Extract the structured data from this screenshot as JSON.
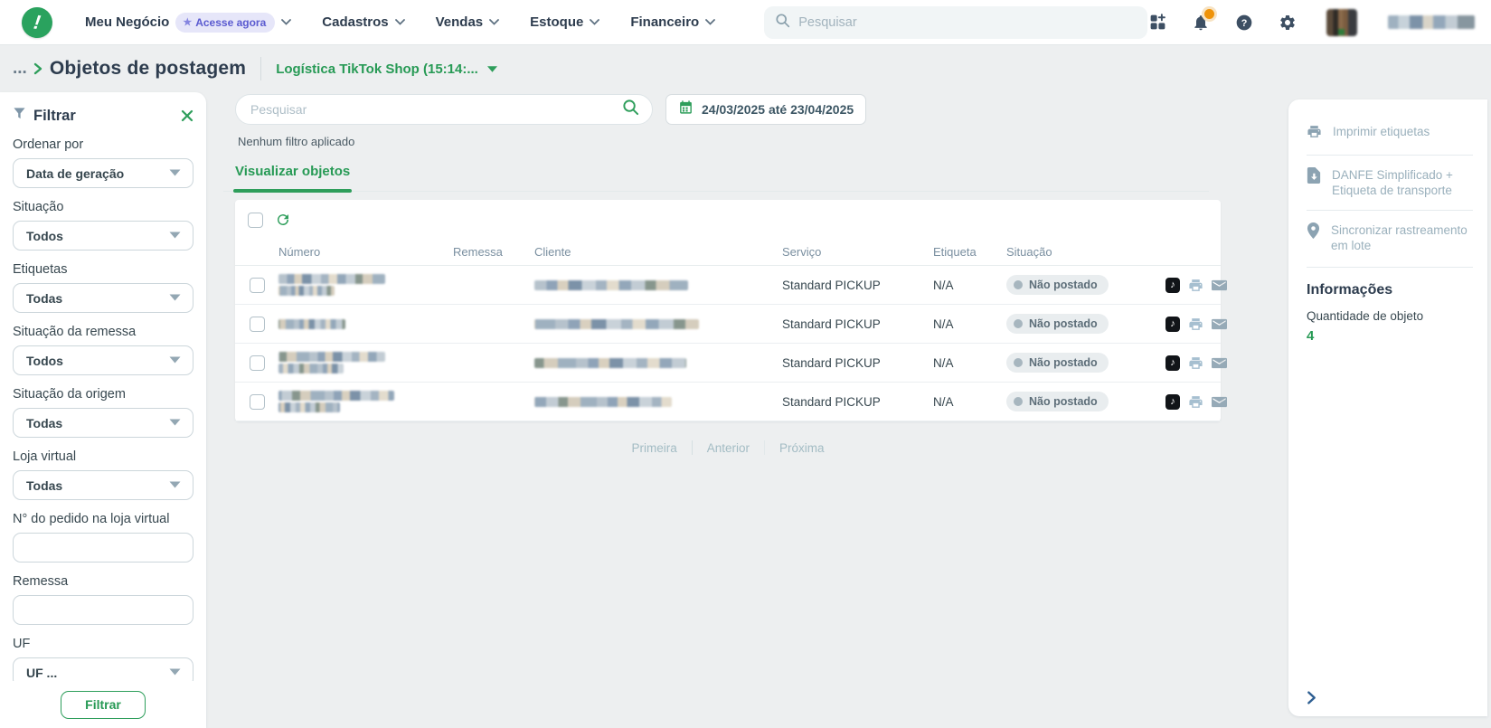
{
  "topbar": {
    "logo_glyph": "!",
    "menu": [
      {
        "label": "Meu Negócio",
        "badge": "Acesse agora"
      },
      {
        "label": "Cadastros"
      },
      {
        "label": "Vendas"
      },
      {
        "label": "Estoque"
      },
      {
        "label": "Financeiro"
      }
    ],
    "search_placeholder": "Pesquisar",
    "icons": [
      "apps-grid-plus-icon",
      "notifications-bell-icon",
      "help-icon",
      "settings-gear-icon"
    ]
  },
  "breadcrumb": {
    "ellipsis": "...",
    "title": "Objetos de postagem",
    "context_selector": "Logística TikTok Shop (15:14:..."
  },
  "filter_panel": {
    "title": "Filtrar",
    "fields": [
      {
        "label": "Ordenar por",
        "type": "select",
        "value": "Data de geração"
      },
      {
        "label": "Situação",
        "type": "select",
        "value": "Todos"
      },
      {
        "label": "Etiquetas",
        "type": "select",
        "value": "Todas"
      },
      {
        "label": "Situação da remessa",
        "type": "select",
        "value": "Todos"
      },
      {
        "label": "Situação da origem",
        "type": "select",
        "value": "Todas"
      },
      {
        "label": "Loja virtual",
        "type": "select",
        "value": "Todas"
      },
      {
        "label": "N° do pedido na loja virtual",
        "type": "input",
        "value": ""
      },
      {
        "label": "Remessa",
        "type": "input",
        "value": ""
      },
      {
        "label": "UF",
        "type": "select",
        "value": "UF ..."
      }
    ],
    "submit_label": "Filtrar"
  },
  "toolbar": {
    "search_placeholder": "Pesquisar",
    "date_range": "24/03/2025 até 23/04/2025",
    "filter_status": "Nenhum filtro aplicado"
  },
  "tabs": [
    {
      "label": "Visualizar objetos",
      "active": true
    }
  ],
  "table": {
    "columns": [
      "Número",
      "Remessa",
      "Cliente",
      "Serviço",
      "Etiqueta",
      "Situação"
    ],
    "rows": [
      {
        "numero_redacted_lines": 2,
        "remessa": "",
        "cliente_redacted": true,
        "servico": "Standard PICKUP",
        "etiqueta": "N/A",
        "situacao": "Não postado"
      },
      {
        "numero_redacted_lines": 1,
        "remessa": "",
        "cliente_redacted": true,
        "servico": "Standard PICKUP",
        "etiqueta": "N/A",
        "situacao": "Não postado"
      },
      {
        "numero_redacted_lines": 2,
        "remessa": "",
        "cliente_redacted": true,
        "servico": "Standard PICKUP",
        "etiqueta": "N/A",
        "situacao": "Não postado"
      },
      {
        "numero_redacted_lines": 2,
        "remessa": "",
        "cliente_redacted": true,
        "servico": "Standard PICKUP",
        "etiqueta": "N/A",
        "situacao": "Não postado"
      }
    ],
    "row_action_icons": [
      "tiktok-shop-icon",
      "print-icon",
      "email-icon"
    ]
  },
  "pagination": {
    "links": [
      "Primeira",
      "Anterior",
      "Próxima"
    ]
  },
  "side_panel": {
    "actions": [
      {
        "label": "Imprimir etiquetas",
        "icon": "print-icon"
      },
      {
        "label": "DANFE Simplificado + Etiqueta de transporte",
        "icon": "file-download-icon"
      },
      {
        "label": "Sincronizar rastreamento em lote",
        "icon": "map-pin-icon"
      }
    ],
    "info_title": "Informações",
    "info_label": "Quantidade de objeto",
    "info_value": "4"
  },
  "colors": {
    "accent_green": "#2e9e5b",
    "navy_text": "#2d3c4e",
    "badge_purple": "#5a5ad0",
    "notification_orange": "#ef9309",
    "status_pill_bg": "#e9edef"
  }
}
